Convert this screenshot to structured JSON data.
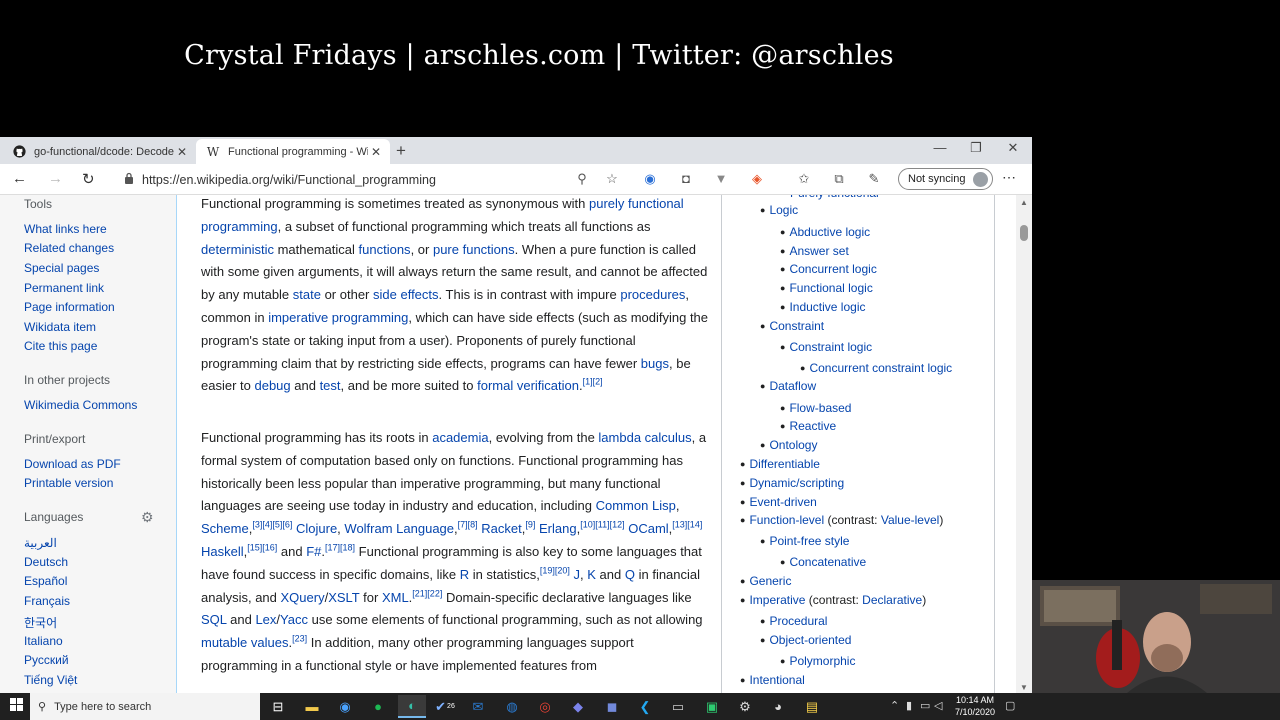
{
  "banner": {
    "text": "Crystal Fridays | arschles.com | Twitter: @arschles"
  },
  "browser": {
    "tabs": [
      {
        "label": "go-functional/dcode: Decode JS",
        "icon": "github-icon",
        "active": false
      },
      {
        "label": "Functional programming - Wikip",
        "icon": "wikipedia-icon",
        "active": true
      }
    ],
    "address": {
      "url": "https://en.wikipedia.org/wiki/Functional_programming"
    },
    "sync_label": "Not syncing"
  },
  "sidebar": {
    "tools_heading": "Tools",
    "tools": [
      "What links here",
      "Related changes",
      "Special pages",
      "Permanent link",
      "Page information",
      "Wikidata item",
      "Cite this page"
    ],
    "other_heading": "In other projects",
    "other": [
      "Wikimedia Commons"
    ],
    "print_heading": "Print/export",
    "print": [
      "Download as PDF",
      "Printable version"
    ],
    "lang_heading": "Languages",
    "languages": [
      "العربية",
      "Deutsch",
      "Español",
      "Français",
      "한국어",
      "Italiano",
      "Русский",
      "Tiếng Việt"
    ]
  },
  "navbox": {
    "cut_top": "Purely functional",
    "items": [
      {
        "text": "Logic",
        "level": 2
      },
      {
        "text": "Abductive logic",
        "level": 3
      },
      {
        "text": "Answer set",
        "level": 3
      },
      {
        "text": "Concurrent logic",
        "level": 3
      },
      {
        "text": "Functional logic",
        "level": 3
      },
      {
        "text": "Inductive logic",
        "level": 3
      },
      {
        "text": "Constraint",
        "level": 2
      },
      {
        "text": "Constraint logic",
        "level": 3
      },
      {
        "text": "Concurrent constraint logic",
        "level": 4
      },
      {
        "text": "Dataflow",
        "level": 2
      },
      {
        "text": "Flow-based",
        "level": 3
      },
      {
        "text": "Reactive",
        "level": 3
      },
      {
        "text": "Ontology",
        "level": 2
      },
      {
        "text": "Differentiable",
        "level": 1
      },
      {
        "text": "Dynamic/scripting",
        "level": 1
      },
      {
        "text": "Event-driven",
        "level": 1
      },
      {
        "text": "Function-level",
        "level": 1,
        "plain": " (contrast: ",
        "link2": "Value-level",
        "tail": ")"
      },
      {
        "text": "Point-free style",
        "level": 2
      },
      {
        "text": "Concatenative",
        "level": 3
      },
      {
        "text": "Generic",
        "level": 1
      },
      {
        "text": "Imperative",
        "level": 1,
        "plain": " (contrast: ",
        "link2": "Declarative",
        "tail": ")"
      },
      {
        "text": "Procedural",
        "level": 2
      },
      {
        "text": "Object-oriented",
        "level": 2
      },
      {
        "text": "Polymorphic",
        "level": 3
      },
      {
        "text": "Intentional",
        "level": 1
      }
    ]
  },
  "taskbar": {
    "search_placeholder": "Type here to search",
    "time": "10:14 AM",
    "date": "7/10/2020",
    "badge": "26"
  }
}
